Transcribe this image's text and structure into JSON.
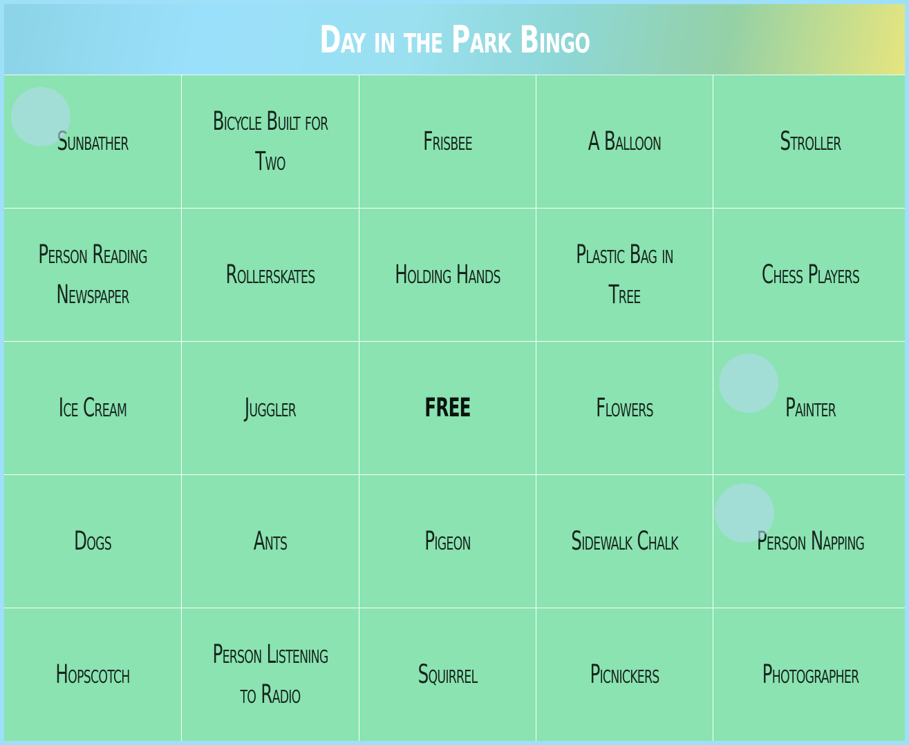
{
  "title": "Day in the Park Bingo",
  "colors": {
    "background": "#9ee0f8",
    "cell": "#8ae3b1",
    "grid_line": "#ffffff",
    "text": "#17241d",
    "marker": "#b2daec"
  },
  "cells": [
    [
      "Sunbather",
      "Bicycle Built for Two",
      "Frisbee",
      "A Balloon",
      "Stroller"
    ],
    [
      "Person Reading Newspaper",
      "Rollerskates",
      "Holding Hands",
      "Plastic Bag in Tree",
      "Chess Players"
    ],
    [
      "Ice Cream",
      "Juggler",
      "FREE",
      "Flowers",
      "Painter"
    ],
    [
      "Dogs",
      "Ants",
      "Pigeon",
      "Sidewalk Chalk",
      "Person Napping"
    ],
    [
      "Hopscotch",
      "Person Listening to Radio",
      "Squirrel",
      "Picnickers",
      "Photographer"
    ]
  ],
  "free_cell": {
    "row": 2,
    "col": 2
  },
  "markers": [
    "marker-icon",
    "marker-icon",
    "marker-icon"
  ]
}
